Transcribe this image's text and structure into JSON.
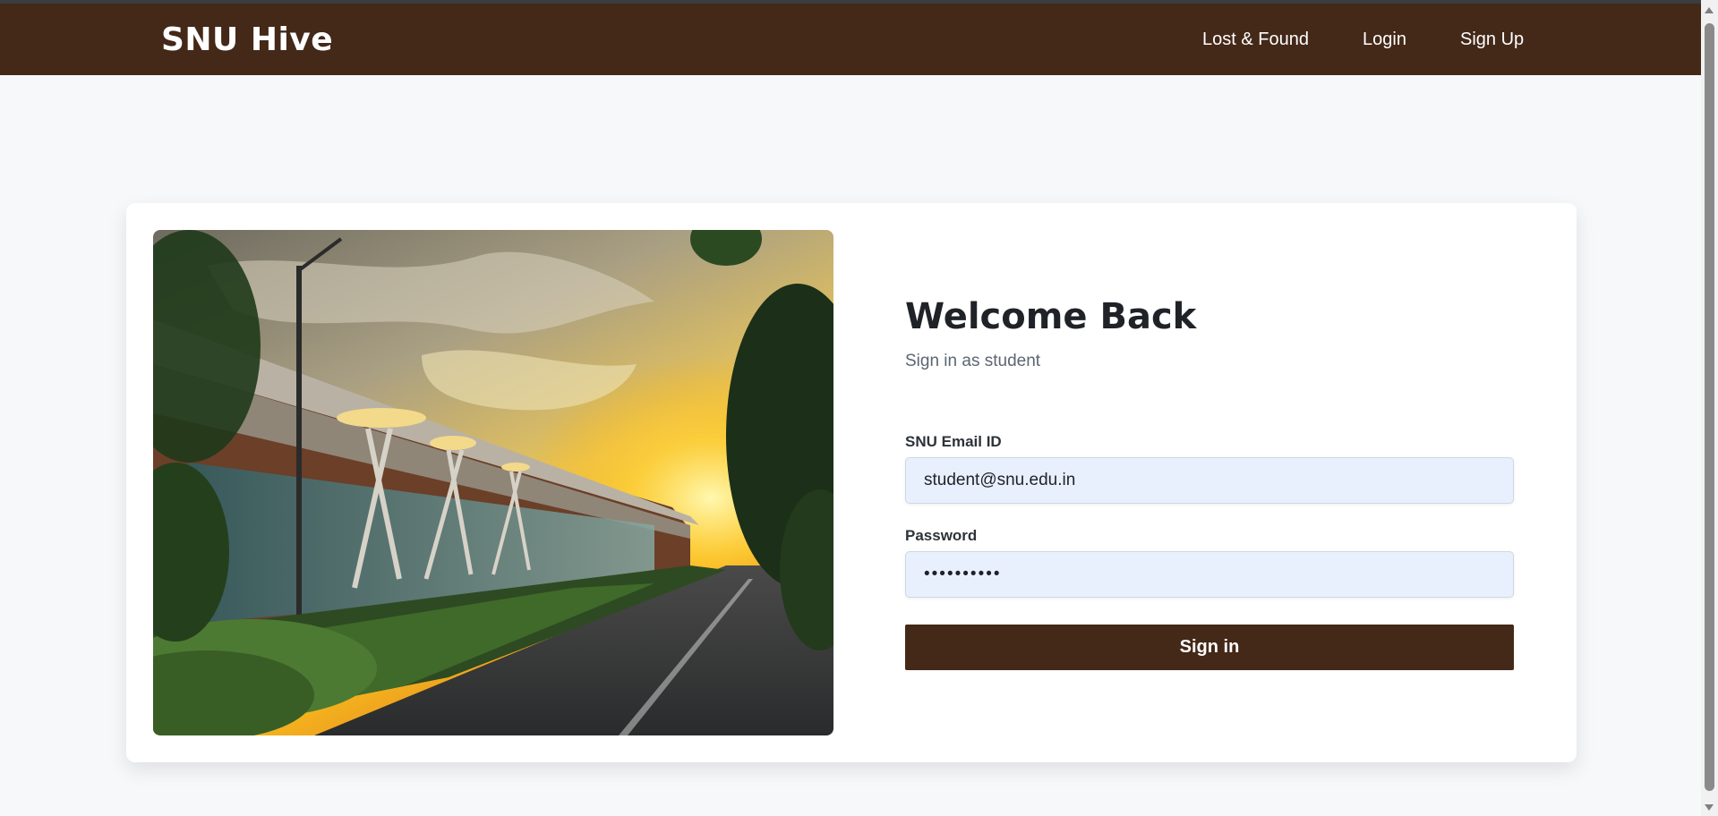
{
  "navbar": {
    "brand": "SNU Hive",
    "links": [
      {
        "label": "Lost & Found"
      },
      {
        "label": "Login"
      },
      {
        "label": "Sign Up"
      }
    ],
    "background_color": "#442818"
  },
  "login": {
    "title": "Welcome Back",
    "subtitle": "Sign in as student",
    "email_label": "SNU Email ID",
    "email_value": "student@snu.edu.in",
    "password_label": "Password",
    "password_value": "••••••••••",
    "submit_label": "Sign in"
  },
  "colors": {
    "accent": "#442818",
    "page_bg": "#f7f8fa",
    "input_bg": "#e8f0fd"
  }
}
